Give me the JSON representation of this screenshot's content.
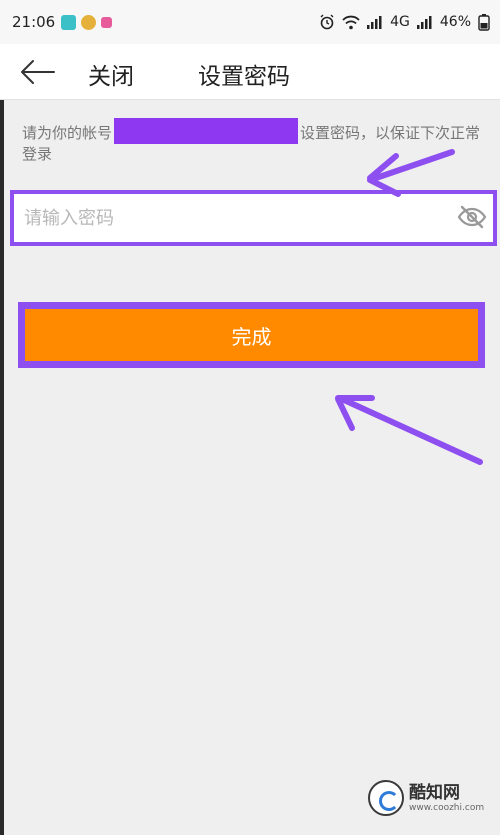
{
  "status_bar": {
    "time": "21:06",
    "network": "4G",
    "battery": "46%"
  },
  "nav": {
    "back_icon": "arrow-left-icon",
    "close_label": "关闭",
    "title": "设置密码"
  },
  "hint": {
    "prefix": "请为你的帐号",
    "suffix": "设置密码，以保证下次正常登录"
  },
  "password": {
    "placeholder": "请输入密码",
    "value": "",
    "toggle_icon": "eye-slash-icon"
  },
  "actions": {
    "done_label": "完成"
  },
  "colors": {
    "accent": "#ff8a00",
    "annotation": "#8e4ff0",
    "redaction": "#8f38f2"
  },
  "watermark": {
    "name": "酷知网",
    "url": "www.coozhi.com"
  }
}
